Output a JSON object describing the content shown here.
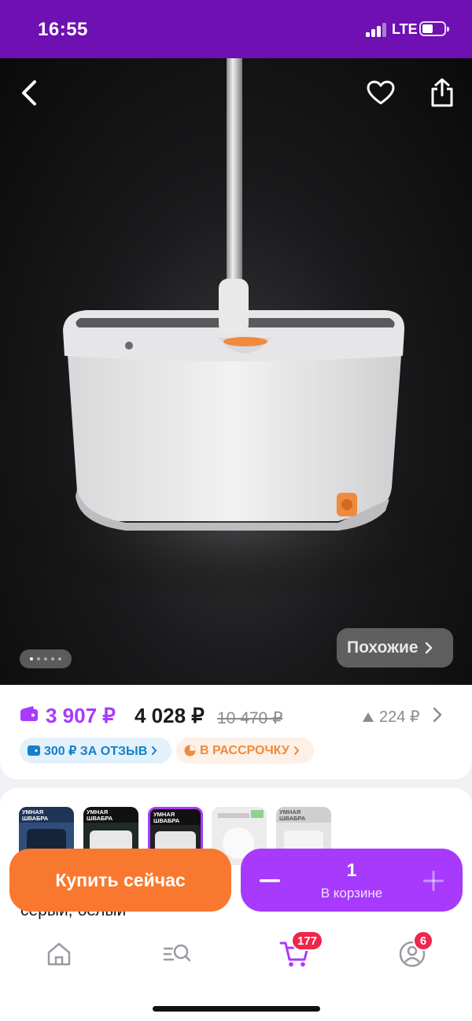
{
  "status_bar": {
    "time": "16:55",
    "network": "LTE"
  },
  "hero": {
    "similar_label": "Похожие",
    "gallery_dots": 5,
    "gallery_active": 1
  },
  "price": {
    "wallet_price": "3 907 ₽",
    "regular_price": "4 028 ₽",
    "old_price": "10 470 ₽",
    "delta": "224 ₽",
    "wallet_color": "#a73afd"
  },
  "chips": {
    "review": "300 ₽ ЗА ОТЗЫВ",
    "installment": "В РАССРОЧКУ"
  },
  "variants": {
    "thumbs": [
      {
        "title": "УМНАЯ ШВАБРА",
        "selected": false
      },
      {
        "title": "УМНАЯ ШВАБРА",
        "selected": false
      },
      {
        "title": "УМНАЯ ШВАБРА",
        "selected": true
      },
      {
        "title": "",
        "selected": false
      },
      {
        "title": "УМНАЯ ШВАБРА",
        "selected": false
      }
    ],
    "color_text": "серый, белый"
  },
  "actions": {
    "buy_now": "Купить сейчас",
    "quantity": "1",
    "in_cart": "В корзине"
  },
  "tabbar": {
    "cart_badge": "177",
    "profile_badge": "6",
    "accent": "#a73afd"
  }
}
